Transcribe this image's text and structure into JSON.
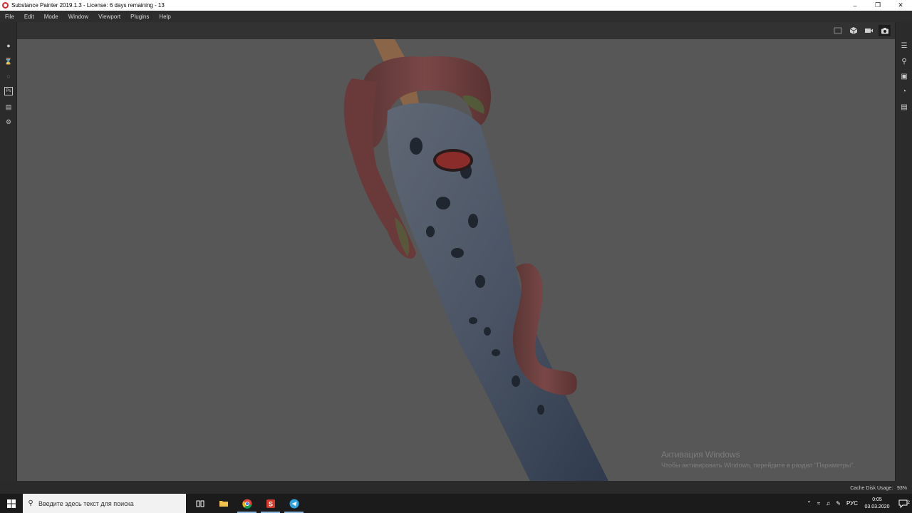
{
  "window": {
    "title": "Substance Painter 2019.1.3 - License: 6 days remaining - 13",
    "controls": [
      "minimize",
      "maximize",
      "close"
    ]
  },
  "menu": [
    "File",
    "Edit",
    "Mode",
    "Window",
    "Viewport",
    "Plugins",
    "Help"
  ],
  "viewport_tools": [
    "frame-icon",
    "cube-icon",
    "video-camera-icon",
    "camera-icon"
  ],
  "left_toolbar": [
    "paint-brush-icon",
    "eraser-icon",
    "projection-icon",
    "ps-export-icon",
    "document-icon",
    "settings-icon"
  ],
  "left_toolbar_ps_label": "Ps",
  "right_toolbar": [
    "layers-icon",
    "zoom-icon",
    "display-settings-icon",
    "environment-icon",
    "texture-set-icon"
  ],
  "watermark": {
    "title": "Активация Windows",
    "subtitle": "Чтобы активировать Windows, перейдите в раздел \"Параметры\"."
  },
  "status": {
    "cache_label": "Cache Disk Usage:",
    "cache_value": "93%"
  },
  "taskbar": {
    "search_placeholder": "Введите здесь текст для поиска",
    "apps": [
      "task-view-icon",
      "file-explorer-icon",
      "chrome-icon",
      "substance-painter-icon",
      "telegram-icon"
    ],
    "tray_language": "РУС",
    "time": "0:05",
    "date": "03.03.2020",
    "notification_count": "2"
  }
}
